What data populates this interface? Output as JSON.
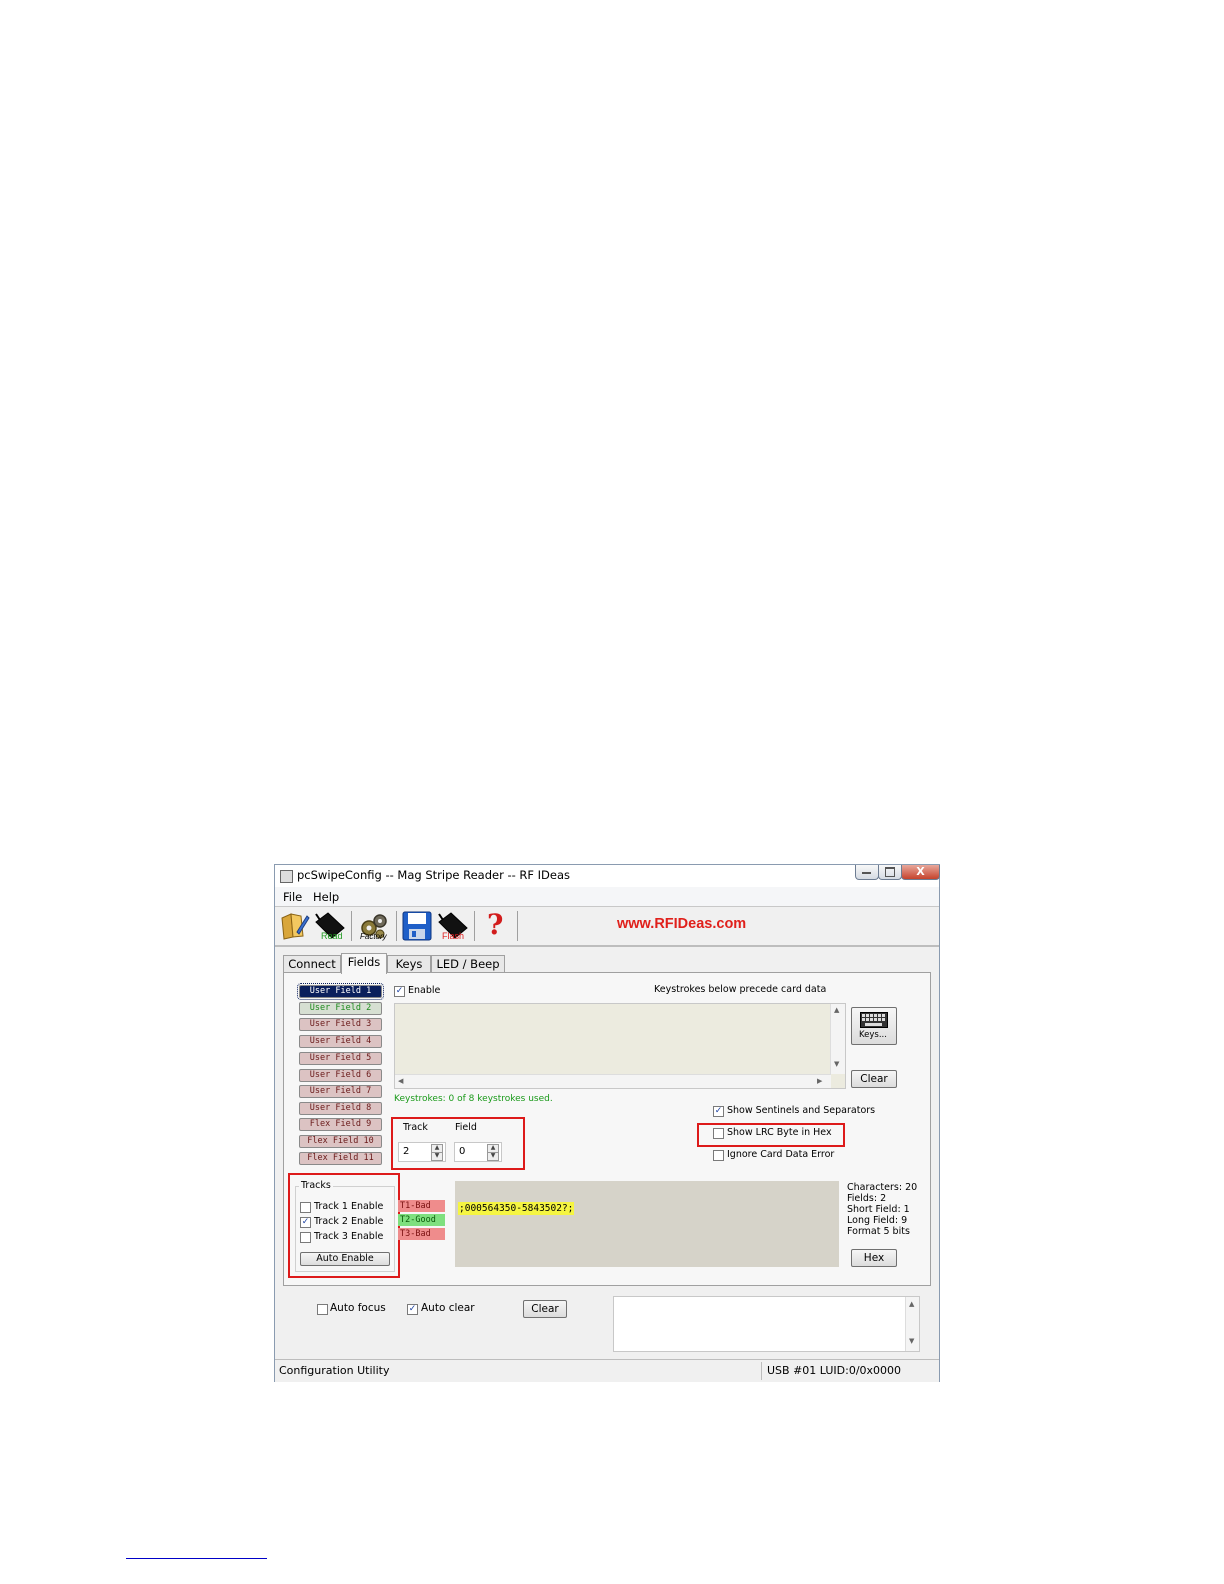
{
  "window": {
    "title": "pcSwipeConfig -- Mag Stripe Reader -- RF IDeas",
    "close_glyph": "X"
  },
  "menu": {
    "file": "File",
    "help": "Help"
  },
  "toolbar": {
    "read_label": "Read",
    "factory_label": "Factory",
    "flash_label": "Flash",
    "help_glyph": "?",
    "website": "www.RFIDeas.com"
  },
  "tabs": [
    "Connect",
    "Fields",
    "Keys",
    "LED / Beep"
  ],
  "fields": {
    "buttons": [
      "User Field 1",
      "User Field 2",
      "User Field 3",
      "User Field 4",
      "User Field 5",
      "User Field 6",
      "User Field 7",
      "User Field 8",
      "Flex Field 9",
      "Flex Field 10",
      "Flex Field 11"
    ],
    "enable_label": "Enable",
    "enable_checked": true,
    "keystrokes_header": "Keystrokes below precede card data",
    "keys_button": "Keys...",
    "clear_button": "Clear",
    "keystrokes_used": "Keystrokes: 0 of 8 keystrokes used.",
    "track_label": "Track",
    "track_value": "2",
    "field_label": "Field",
    "field_value": "0",
    "options": {
      "show_sentinels": "Show Sentinels and Separators",
      "show_sentinels_checked": true,
      "show_lrc": "Show LRC Byte in Hex",
      "show_lrc_checked": false,
      "ignore_error": "Ignore Card Data Error",
      "ignore_error_checked": false
    },
    "tracks": {
      "group_label": "Tracks",
      "track1": "Track 1 Enable",
      "track2": "Track 2 Enable",
      "track3": "Track 3 Enable",
      "track1_checked": false,
      "track2_checked": true,
      "track3_checked": false,
      "auto_enable": "Auto Enable"
    },
    "track_status": [
      "T1-Bad",
      "T2-Good",
      "T3-Bad"
    ],
    "card_data": ";000564350-5843502?;",
    "info": {
      "characters": "Characters: 20",
      "fields": "Fields: 2",
      "short_field": "Short Field: 1",
      "long_field": "Long  Field: 9",
      "format": "Format 5 bits"
    },
    "hex_button": "Hex"
  },
  "bottom": {
    "auto_focus": "Auto focus",
    "auto_focus_checked": false,
    "auto_clear": "Auto clear",
    "auto_clear_checked": true,
    "clear_button": "Clear"
  },
  "status": {
    "left": "Configuration Utility",
    "right": "USB #01 LUID:0/0x0000"
  },
  "colors": {
    "highlight_red": "#dd1a1a",
    "website_red": "#e0201b",
    "track_bad": "#ef8c8c",
    "track_good": "#7fe07f",
    "card_highlight": "#f5f542"
  }
}
